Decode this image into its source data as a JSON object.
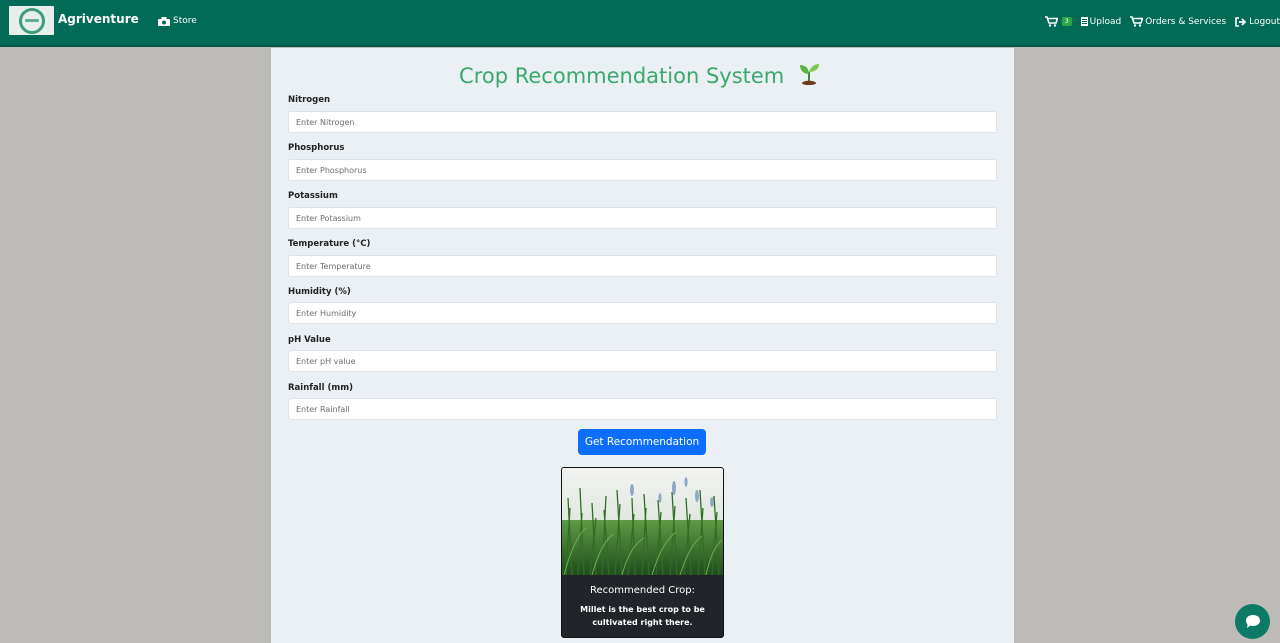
{
  "navbar": {
    "brand": "Agriventure",
    "store": "Store",
    "cart_count": "3",
    "upload": "Upload",
    "orders": "Orders & Services",
    "logout": "Logout"
  },
  "page": {
    "title": "Crop Recommendation System"
  },
  "form": {
    "fields": [
      {
        "label": "Nitrogen",
        "placeholder": "Enter Nitrogen"
      },
      {
        "label": "Phosphorus",
        "placeholder": "Enter Phosphorus"
      },
      {
        "label": "Potassium",
        "placeholder": "Enter Potassium"
      },
      {
        "label": "Temperature (°C)",
        "placeholder": "Enter Temperature"
      },
      {
        "label": "Humidity (%)",
        "placeholder": "Enter Humidity"
      },
      {
        "label": "pH Value",
        "placeholder": "Enter pH value"
      },
      {
        "label": "Rainfall (mm)",
        "placeholder": "Enter Rainfall"
      }
    ],
    "submit": "Get Recommendation"
  },
  "result": {
    "title": "Recommended Crop:",
    "text": "Millet is the best crop to be cultivated right there."
  },
  "colors": {
    "navbar": "#026b55",
    "title": "#3aa96c",
    "button": "#0d6efd"
  }
}
